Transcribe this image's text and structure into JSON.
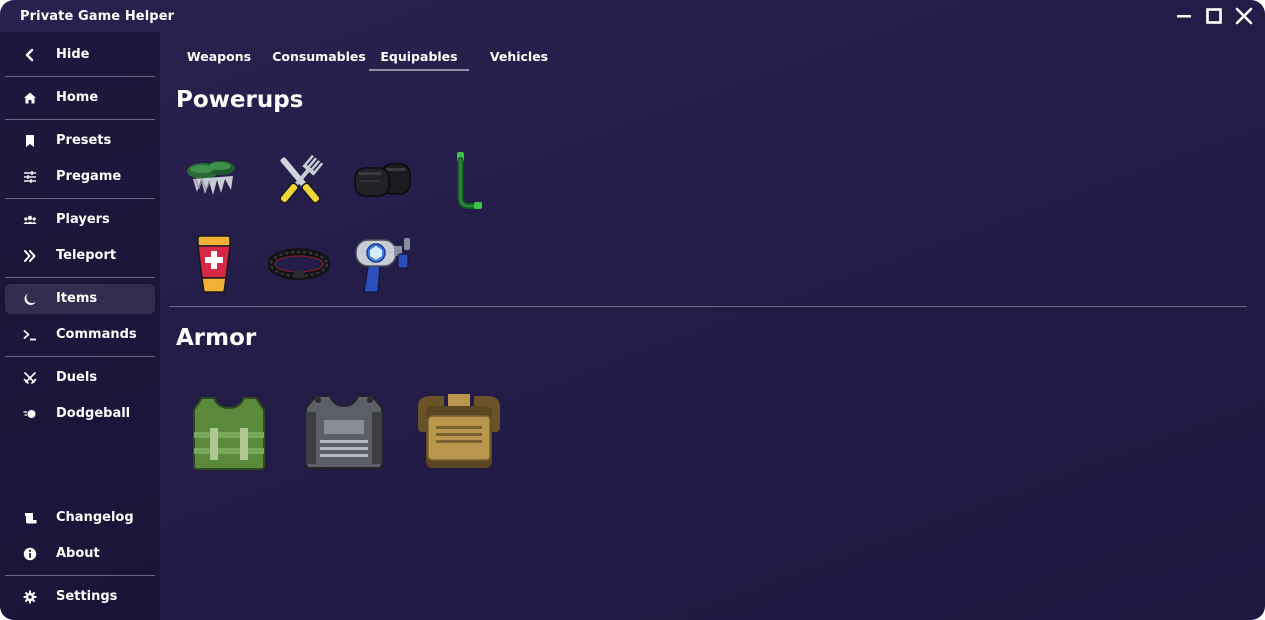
{
  "window": {
    "title": "Private Game Helper",
    "controls": [
      "minimize-icon",
      "maximize-icon",
      "close-icon"
    ]
  },
  "sidebar": {
    "hide": {
      "label": "Hide",
      "icon": "chevron-left-icon"
    },
    "items": [
      {
        "label": "Home",
        "icon": "home-icon"
      },
      {
        "label": "Presets",
        "icon": "bookmark-icon"
      },
      {
        "label": "Pregame",
        "icon": "sliders-icon"
      },
      {
        "label": "Players",
        "icon": "users-icon"
      },
      {
        "label": "Teleport",
        "icon": "double-chevron-right-icon"
      },
      {
        "label": "Items",
        "icon": "moon-icon",
        "active": true
      },
      {
        "label": "Commands",
        "icon": "terminal-icon"
      },
      {
        "label": "Duels",
        "icon": "crossed-swords-icon"
      },
      {
        "label": "Dodgeball",
        "icon": "ball-icon"
      },
      {
        "label": "Changelog",
        "icon": "scroll-icon"
      },
      {
        "label": "About",
        "icon": "info-icon"
      },
      {
        "label": "Settings",
        "icon": "gear-icon"
      }
    ]
  },
  "tabs": [
    {
      "label": "Weapons"
    },
    {
      "label": "Consumables"
    },
    {
      "label": "Equipables",
      "active": true
    },
    {
      "label": "Vehicles"
    }
  ],
  "sections": {
    "powerups": {
      "title": "Powerups",
      "items": [
        "climbing-claws-icon",
        "fork-knife-icon",
        "black-boots-icon",
        "snorkel-icon",
        "medkit-cup-icon",
        "bullet-belt-icon",
        "grapple-gun-icon"
      ]
    },
    "armor": {
      "title": "Armor",
      "items": [
        "green-vest-icon",
        "gray-vest-icon",
        "tan-armor-icon"
      ]
    }
  },
  "colors": {
    "background": "#231c47",
    "sidebar": "#1a1540",
    "accent_underline": "#8f8fa8"
  }
}
